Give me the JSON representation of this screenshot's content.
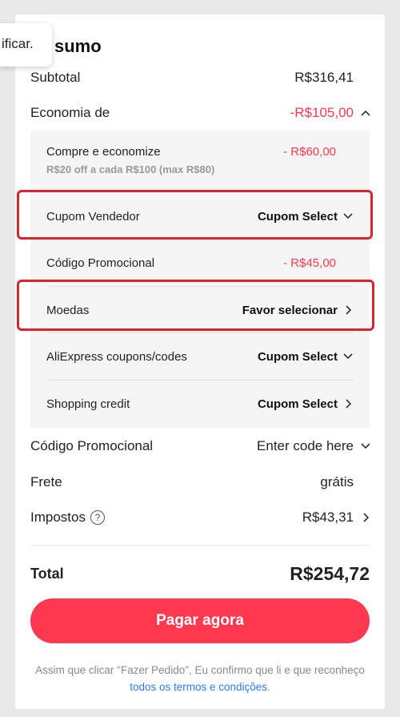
{
  "tooltip": "ificar.",
  "title": "sumo",
  "subtotal": {
    "label": "Subtotal",
    "value": "R$316,41"
  },
  "economia": {
    "label": "Economia de",
    "value": "-R$105,00"
  },
  "panel": {
    "compre": {
      "label": "Compre e economize",
      "value": "- R$60,00",
      "note": "R$20 off a cada R$100 (max R$80)"
    },
    "cupom_vendedor": {
      "label": "Cupom Vendedor",
      "value": "Cupom Select"
    },
    "codigo": {
      "label": "Código Promocional",
      "value": "- R$45,00"
    },
    "moedas": {
      "label": "Moedas",
      "value": "Favor selecionar"
    },
    "aliexpress": {
      "label": "AliExpress coupons/codes",
      "value": "Cupom Select"
    },
    "shopping": {
      "label": "Shopping credit",
      "value": "Cupom Select"
    }
  },
  "promo": {
    "label": "Código Promocional",
    "value": "Enter code here"
  },
  "frete": {
    "label": "Frete",
    "value": "grátis"
  },
  "impostos": {
    "label": "Impostos",
    "value": "R$43,31",
    "help": "?"
  },
  "total": {
    "label": "Total",
    "value": "R$254,72"
  },
  "pay_button": "Pagar agora",
  "legal": {
    "text": "Assim que clicar \"Fazer Pedido\", Eu confirmo que li e que reconheço",
    "link": "todos os termos e condições",
    "end": "."
  },
  "colors": {
    "accent": "#fd384f",
    "link": "#2e7cf6",
    "annotation": "#d7262e"
  }
}
